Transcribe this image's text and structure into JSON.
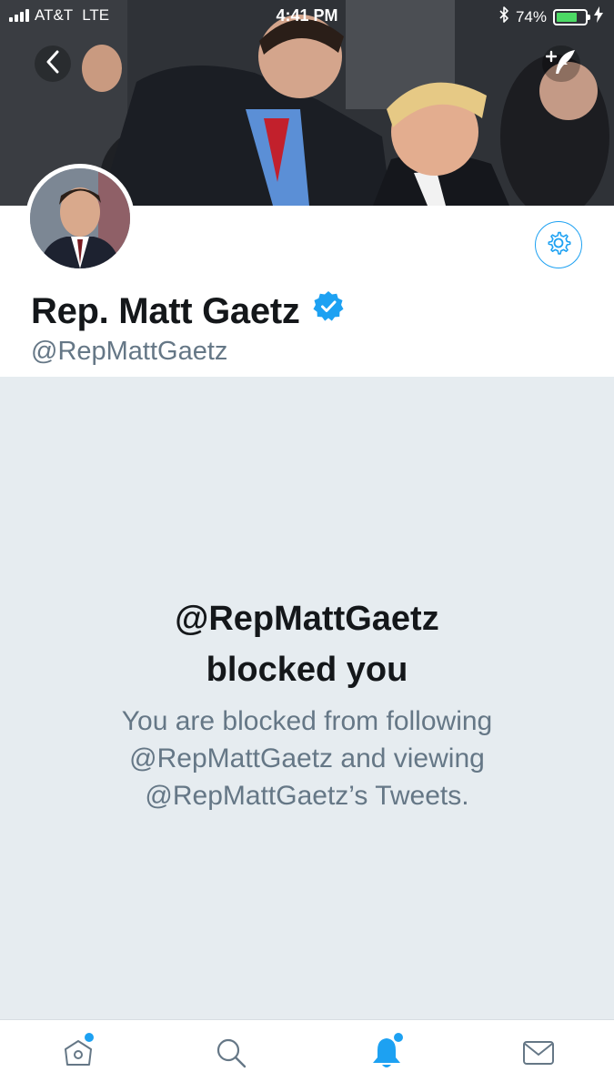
{
  "status_bar": {
    "carrier": "AT&T",
    "network": "LTE",
    "time": "4:41 PM",
    "battery_percent": "74%",
    "battery_level": 0.74,
    "icons": [
      "signal-icon",
      "bluetooth-icon",
      "battery-icon",
      "charging-icon"
    ]
  },
  "header": {
    "back_icon": "chevron-left-icon",
    "compose_icon": "compose-tweet-icon"
  },
  "profile": {
    "name": "Rep. Matt Gaetz",
    "handle": "@RepMattGaetz",
    "verified": true,
    "settings_icon": "gear-icon"
  },
  "blocked": {
    "title_line1": "@RepMattGaetz",
    "title_line2": "blocked you",
    "desc_line1": "You are blocked from following",
    "desc_line2": "@RepMattGaetz and viewing",
    "desc_line3": "@RepMattGaetz’s Tweets."
  },
  "tab_bar": {
    "tabs": [
      {
        "icon": "home-icon",
        "has_dot": true
      },
      {
        "icon": "search-icon",
        "has_dot": false
      },
      {
        "icon": "notifications-icon",
        "has_dot": true,
        "active": true
      },
      {
        "icon": "messages-icon",
        "has_dot": false
      }
    ]
  },
  "colors": {
    "accent": "#1da1f2",
    "text_primary": "#14171a",
    "text_secondary": "#657786",
    "panel_bg": "#e6ecf0",
    "battery_green": "#4cd964"
  }
}
